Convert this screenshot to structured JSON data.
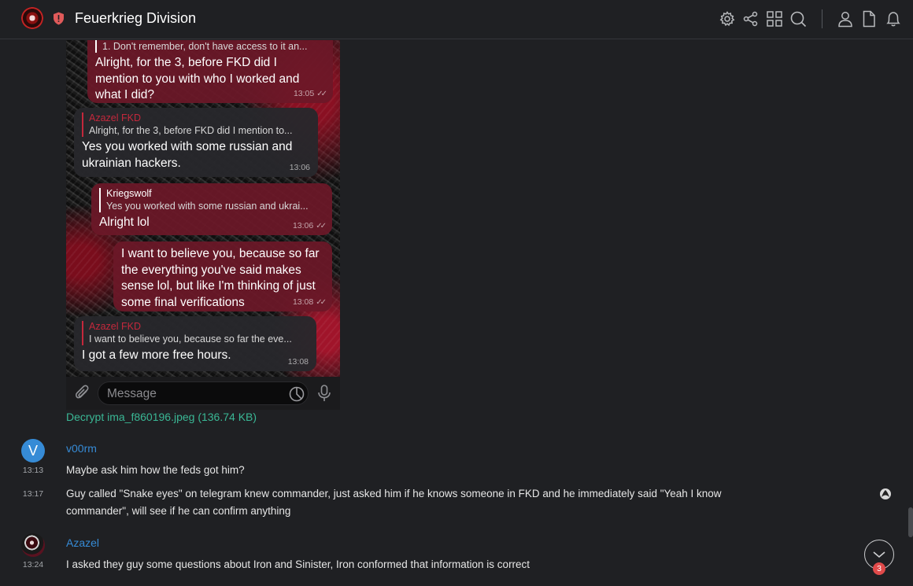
{
  "header": {
    "room_name": "Feuerkrieg Division",
    "icons": [
      "room-settings-icon",
      "share-icon",
      "apps-icon",
      "search-icon",
      "member-list-icon",
      "files-icon",
      "notifications-icon"
    ]
  },
  "embedded_screenshot": {
    "bubbles": [
      {
        "reply_text": "1. Don't remember, don't have access to it an...",
        "text_lines": [
          "Alright, for the 3, before FKD did I",
          "mention to you with who I worked and",
          "what I did?"
        ],
        "time": "13:05"
      },
      {
        "reply_name": "Azazel FKD",
        "reply_text": "Alright, for the 3, before FKD did I mention to...",
        "text_lines": [
          "Yes you worked with some russian and",
          "ukrainian hackers."
        ],
        "time": "13:06"
      },
      {
        "reply_name": "Kriegswolf",
        "reply_text": "Yes you worked with some russian and ukrai...",
        "text_lines": [
          "Alright lol"
        ],
        "time": "13:06"
      },
      {
        "text_lines": [
          "I want to believe you, because so far",
          "the everything you've said makes",
          "sense lol, but like I'm thinking of just",
          "some final verifications"
        ],
        "time": "13:08"
      },
      {
        "reply_name": "Azazel FKD",
        "reply_text": "I want to believe you, because so far the eve...",
        "text_lines": [
          "I got a few more free hours."
        ],
        "time": "13:08"
      }
    ],
    "composer_placeholder": "Message"
  },
  "attachment": {
    "decrypt_link": "Decrypt ima_f860196.jpeg (136.74 KB)"
  },
  "messages": [
    {
      "sender": "v00rm",
      "avatar_letter": "V",
      "time": "13:13",
      "body": "Maybe ask him how the feds got him?"
    },
    {
      "time": "13:17",
      "body_lines": [
        "Guy called \"Snake eyes\" on telegram knew commander, just asked him if he knows someone in FKD and he immediately said \"Yeah I know",
        "commander\", will see if he can confirm anything"
      ]
    },
    {
      "sender": "Azazel",
      "time": "13:24",
      "body": "I asked they guy some questions about Iron and Sinister, Iron conformed that information is correct"
    }
  ],
  "jump_to_bottom": {
    "unread_count": "3"
  },
  "colors": {
    "background": "#1f2023",
    "accent": "#368bd6",
    "link": "#3ab795",
    "badge": "#e04a4a"
  }
}
